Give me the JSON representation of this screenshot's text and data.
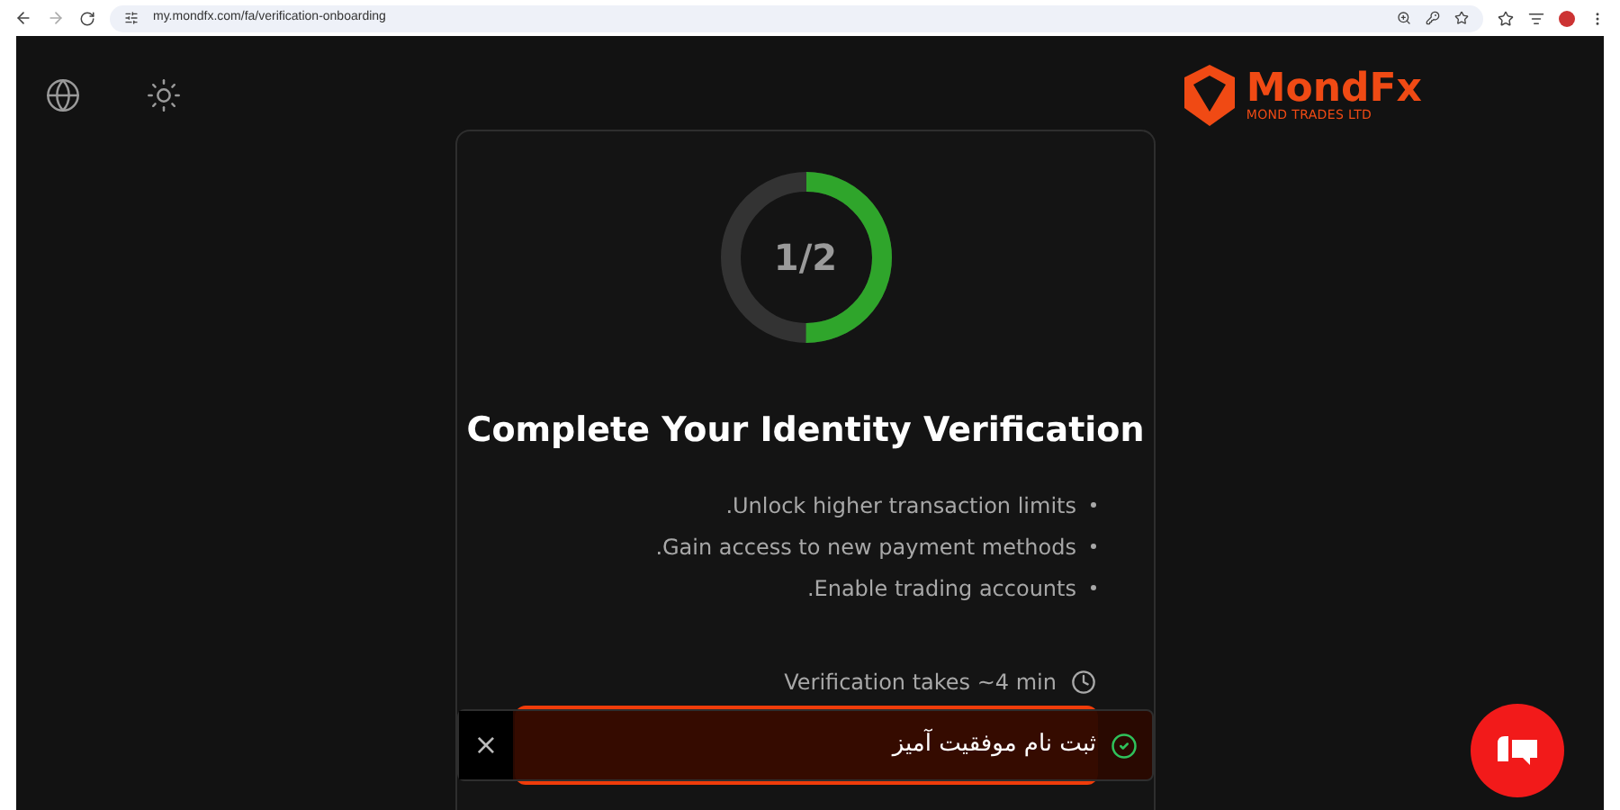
{
  "browser": {
    "url": "my.mondfx.com/fa/verification-onboarding"
  },
  "logo": {
    "name": "MondFx",
    "tagline": "MOND TRADES LTD"
  },
  "progress": {
    "label": "1/2",
    "level": 0.5
  },
  "title": "Complete Your Identity Verification",
  "benefits": [
    ".Unlock higher transaction limits",
    ".Gain access to new payment methods",
    ".Enable trading accounts"
  ],
  "duration": "Verification takes ~4 min",
  "toast": {
    "message": "ثبت نام موفقیت آمیز",
    "close": "×"
  }
}
